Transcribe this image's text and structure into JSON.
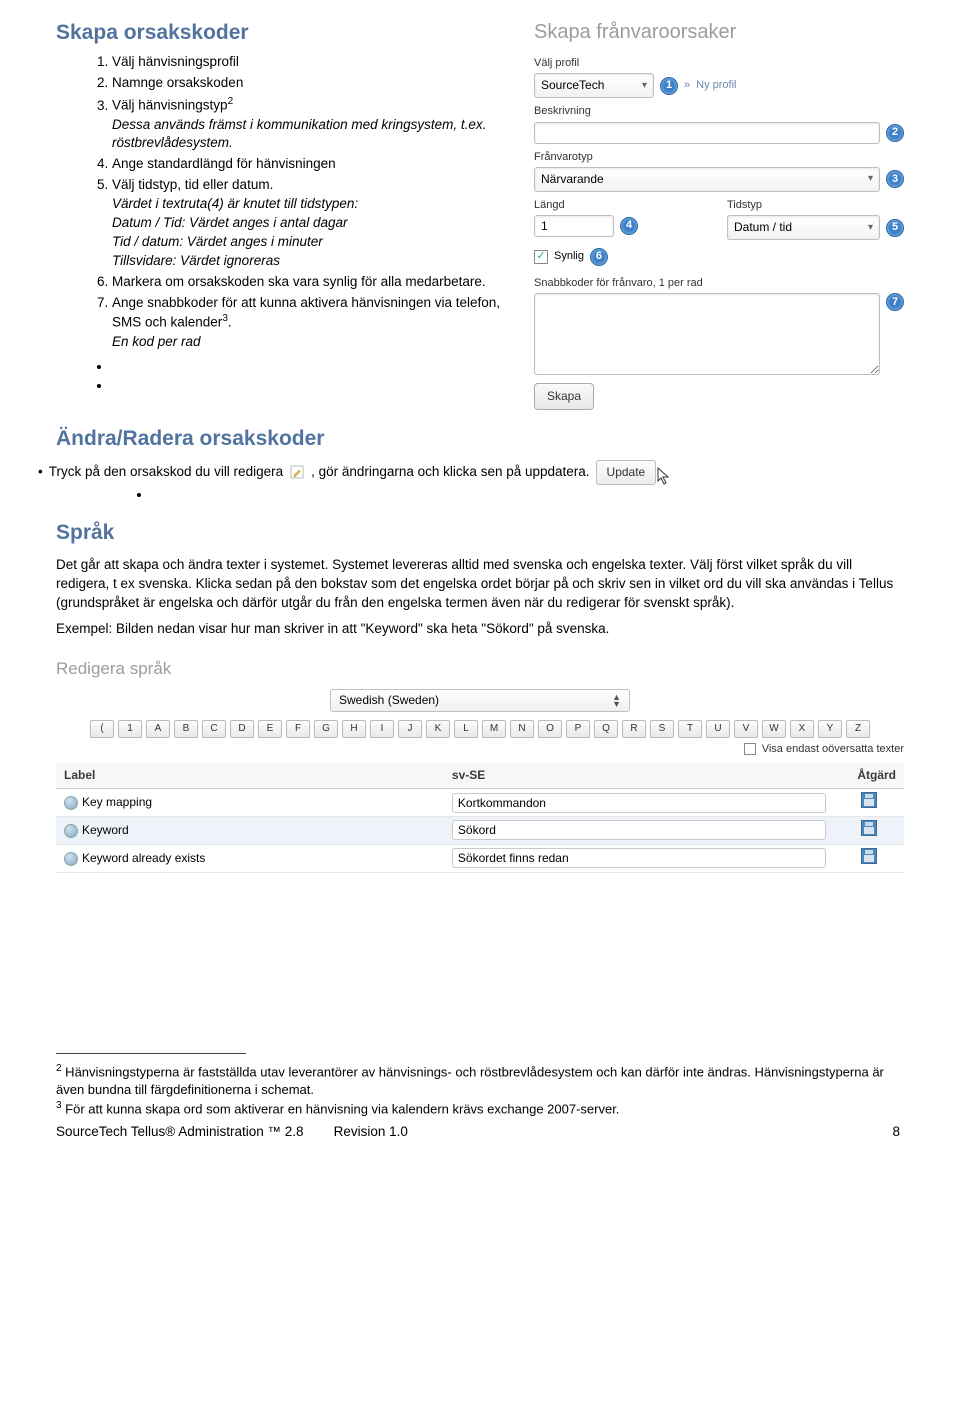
{
  "section1": {
    "title": "Skapa orsakskoder",
    "steps": [
      {
        "text": "Välj hänvisningsprofil"
      },
      {
        "text": "Namnge orsakskoden"
      },
      {
        "text_a": "Välj hänvisningstyp",
        "sup": "2",
        "text_b": "Dessa används främst i kommunikation med kringsystem, t.ex. röstbrevlådesystem.",
        "italic_b": true
      },
      {
        "text": "Ange standardlängd för hänvisningen"
      },
      {
        "text_a": "Välj tidstyp, tid eller datum.",
        "text_b": "Värdet i textruta(4) är knutet till tidstypen:\nDatum / Tid: Värdet anges i antal dagar\nTid / datum: Värdet anges i minuter\nTillsvidare: Värdet ignoreras",
        "italic_b": true
      },
      {
        "text": "Markera om orsakskoden ska vara synlig för alla medarbetare."
      },
      {
        "text_a": "Ange snabbkoder för att kunna aktivera hänvisningen via telefon, SMS och kalender",
        "sup": "3",
        "text_post": ".",
        "text_b": "En kod per rad",
        "italic_b": true
      }
    ]
  },
  "panel": {
    "title": "Skapa frånvaroorsaker",
    "label_profile": "Välj profil",
    "profile_value": "SourceTech",
    "crumb_sep": "»",
    "crumb_new": "Ny profil",
    "label_desc": "Beskrivning",
    "label_type": "Frånvarotyp",
    "type_value": "Närvarande",
    "label_len": "Längd",
    "len_value": "1",
    "label_timetype": "Tidstyp",
    "timetype_value": "Datum / tid",
    "visible_label": "Synlig",
    "label_quick": "Snabbkoder för frånvaro, 1 per rad",
    "create_btn": "Skapa"
  },
  "section2": {
    "title": "Ändra/Radera orsakskoder",
    "line_a": "Tryck på den orsakskod du vill redigera",
    "line_b": ", gör ändringarna och klicka sen på uppdatera.",
    "update_btn": "Update"
  },
  "section3": {
    "title": "Språk",
    "para": "Det går att skapa och ändra texter i systemet. Systemet levereras alltid med svenska och engelska texter. Välj först vilket språk du vill redigera, t ex svenska. Klicka sedan på den bokstav som det engelska ordet börjar på och skriv sen in vilket ord du vill ska användas i Tellus (grundspråket är engelska och därför utgår du från den engelska termen även när du redigerar för svenskt språk).",
    "para_italic_word": "engelska",
    "example": "Exempel: Bilden nedan visar hur man skriver in att \"Keyword\" ska heta \"Sökord\" på svenska."
  },
  "lang": {
    "title": "Redigera språk",
    "select_value": "Swedish (Sweden)",
    "alpha": [
      "(",
      "1",
      "A",
      "B",
      "C",
      "D",
      "E",
      "F",
      "G",
      "H",
      "I",
      "J",
      "K",
      "L",
      "M",
      "N",
      "O",
      "P",
      "Q",
      "R",
      "S",
      "T",
      "U",
      "V",
      "W",
      "X",
      "Y",
      "Z"
    ],
    "checkbox_label": "Visa endast oöversatta texter",
    "headers": {
      "label": "Label",
      "sv": "sv-SE",
      "action": "Åtgärd"
    },
    "rows": [
      {
        "label": "Key mapping",
        "sv": "Kortkommandon"
      },
      {
        "label": "Keyword",
        "sv": "Sökord"
      },
      {
        "label": "Keyword already exists",
        "sv": "Sökordet finns redan"
      }
    ]
  },
  "footnotes": {
    "f2_sup": "2",
    "f2": " Hänvisningstyperna är fastställda utav leverantörer av hänvisnings- och röstbrevlådesystem och kan därför inte ändras. Hänvisningstyperna är även bundna till färgdefinitionerna i schemat.",
    "f3_sup": "3",
    "f3": " För att kunna skapa ord som aktiverar en hänvisning via kalendern krävs exchange 2007-server."
  },
  "footer": {
    "left": "SourceTech Tellus® Administration ™ 2.8",
    "mid": "Revision 1.0",
    "page": "8"
  }
}
